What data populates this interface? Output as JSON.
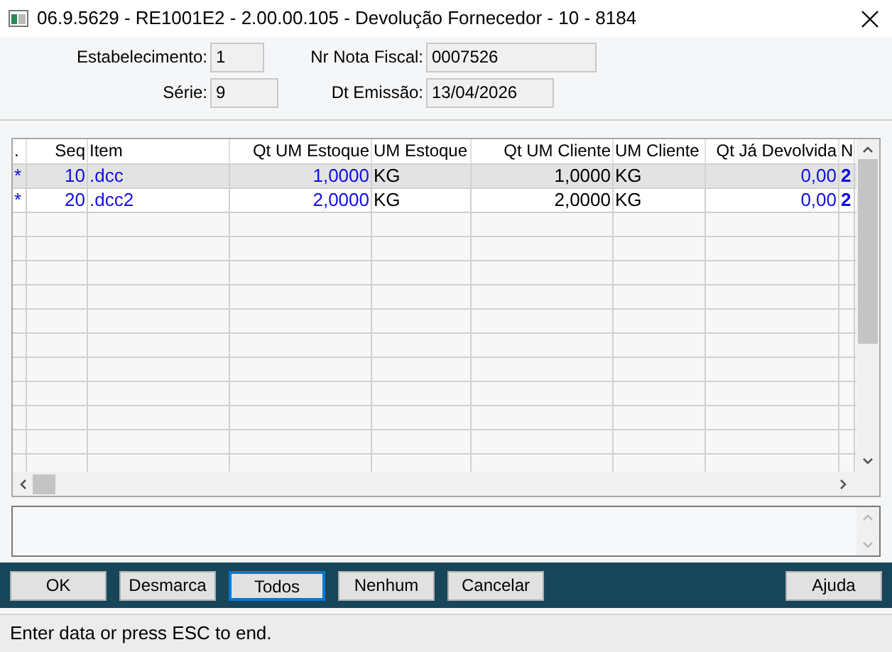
{
  "window": {
    "title": "06.9.5629 - RE1001E2 - 2.00.00.105 - Devolução Fornecedor - 10 - 8184"
  },
  "form": [
    {
      "label": "Estabelecimento:",
      "value": "1"
    },
    {
      "label": "Nr Nota Fiscal:",
      "value": "0007526"
    },
    {
      "label": "Série:",
      "value": "9"
    },
    {
      "label": "Dt Emissão:",
      "value": "13/04/2026"
    }
  ],
  "table": {
    "columns": [
      ".",
      "Seq",
      "Item",
      "Qt UM Estoque",
      "UM Estoque",
      "Qt UM Cliente",
      "UM Cliente",
      "Qt Já Devolvida",
      "N"
    ],
    "rows": [
      {
        "selected": true,
        "cells": [
          "*",
          "10",
          ".dcc",
          "1,0000",
          "KG",
          "1,0000",
          "KG",
          "0,00",
          "2"
        ]
      },
      {
        "selected": false,
        "cells": [
          "*",
          "20",
          ".dcc2",
          "2,0000",
          "KG",
          "2,0000",
          "KG",
          "0,00",
          "2"
        ]
      }
    ]
  },
  "buttons": [
    {
      "label": "OK",
      "focused": false
    },
    {
      "label": "Desmarca",
      "focused": false
    },
    {
      "label": "Todos",
      "focused": true
    },
    {
      "label": "Nenhum",
      "focused": false
    },
    {
      "label": "Cancelar",
      "focused": false
    },
    {
      "label": "Ajuda",
      "focused": false
    }
  ],
  "status_bar": "Enter data or press ESC to end."
}
